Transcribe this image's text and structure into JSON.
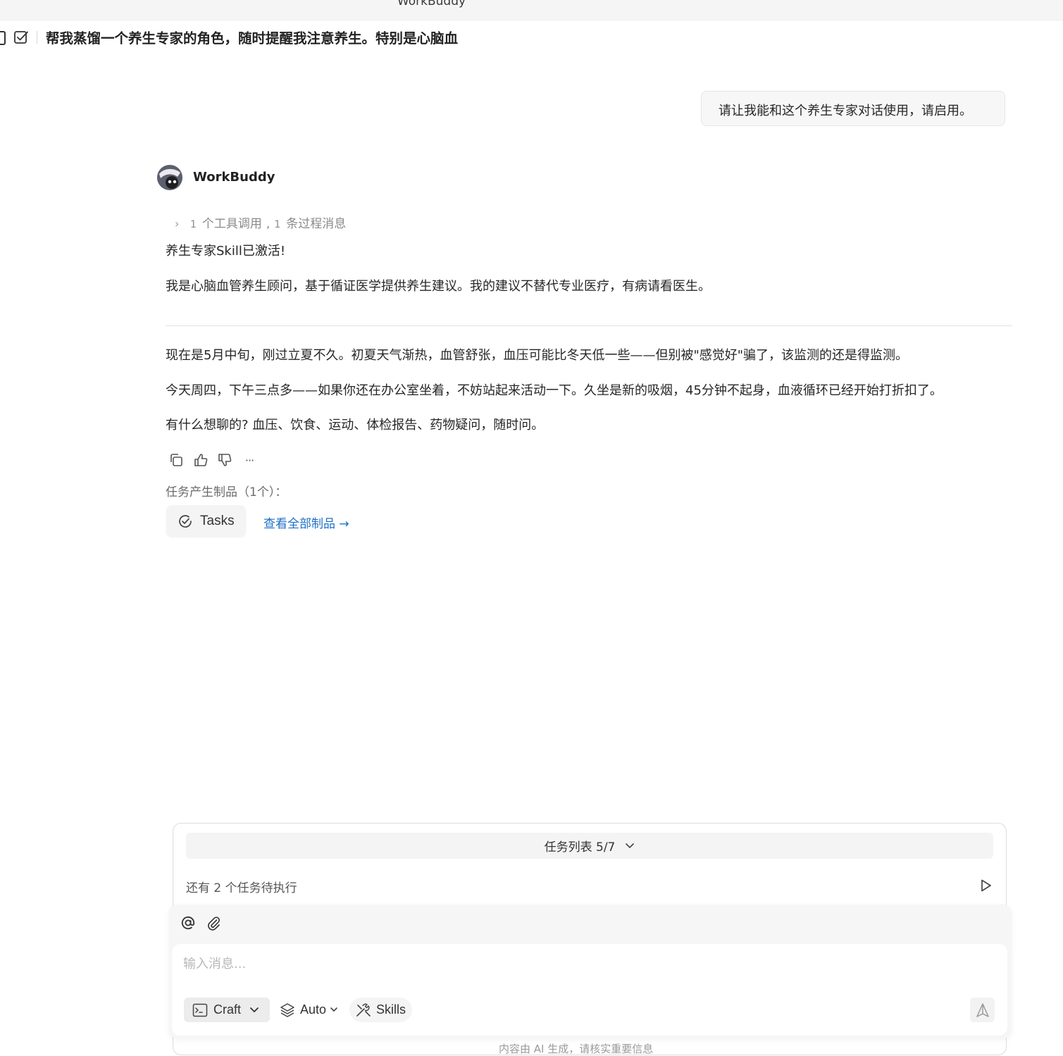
{
  "window": {
    "title": "WorkBuddy"
  },
  "conversation": {
    "title": "帮我蒸馏一个养生专家的角色，随时提醒我注意养生。特别是心脑血"
  },
  "user_message": "请让我能和这个养生专家对话使用，请启用。",
  "assistant": {
    "name": "WorkBuddy",
    "tool_summary": {
      "tool_count": "1",
      "tool_label": "个工具调用",
      "separator": ",",
      "process_count": "1",
      "process_label": "条过程消息"
    },
    "paragraphs_top": [
      "养生专家Skill已激活!",
      "我是心脑血管养生顾问，基于循证医学提供养生建议。我的建议不替代专业医疗，有病请看医生。"
    ],
    "paragraphs_bottom": [
      "现在是5月中旬，刚过立夏不久。初夏天气渐热，血管舒张，血压可能比冬天低一些——但别被\"感觉好\"骗了，该监测的还是得监测。",
      "今天周四，下午三点多——如果你还在办公室坐着，不妨站起来活动一下。久坐是新的吸烟，45分钟不起身，血液循环已经开始打折扣了。",
      "有什么想聊的?  血压、饮食、运动、体检报告、药物疑问，随时问。"
    ],
    "more_actions": "···",
    "artifacts_label": "任务产生制品（1个）：",
    "artifact_chip": "Tasks",
    "view_all": "查看全部制品 →"
  },
  "composer": {
    "task_list_label": "任务列表 5/7",
    "pending_text": "还有 2 个任务待执行",
    "input_placeholder": "输入消息...",
    "mode_label": "Craft",
    "model_label": "Auto",
    "skills_label": "Skills",
    "footer_note": "内容由 AI 生成，请核实重要信息"
  },
  "icons": {
    "header": "task-check-icon",
    "tool_summary": "chevron-right-icon",
    "actions": [
      "copy-icon",
      "thumbs-up-icon",
      "thumbs-down-icon",
      "more-icon"
    ],
    "artifact": "check-circle-icon",
    "task_list": "chevron-down-icon",
    "pending": "play-icon",
    "input": [
      "at-icon",
      "paperclip-icon"
    ],
    "mode": "terminal-icon",
    "model": "layers-icon",
    "skills": "tools-icon",
    "send": "send-icon"
  },
  "colors": {
    "link": "#1e6fc7",
    "text": "#262626",
    "muted": "#8a8a8a"
  }
}
